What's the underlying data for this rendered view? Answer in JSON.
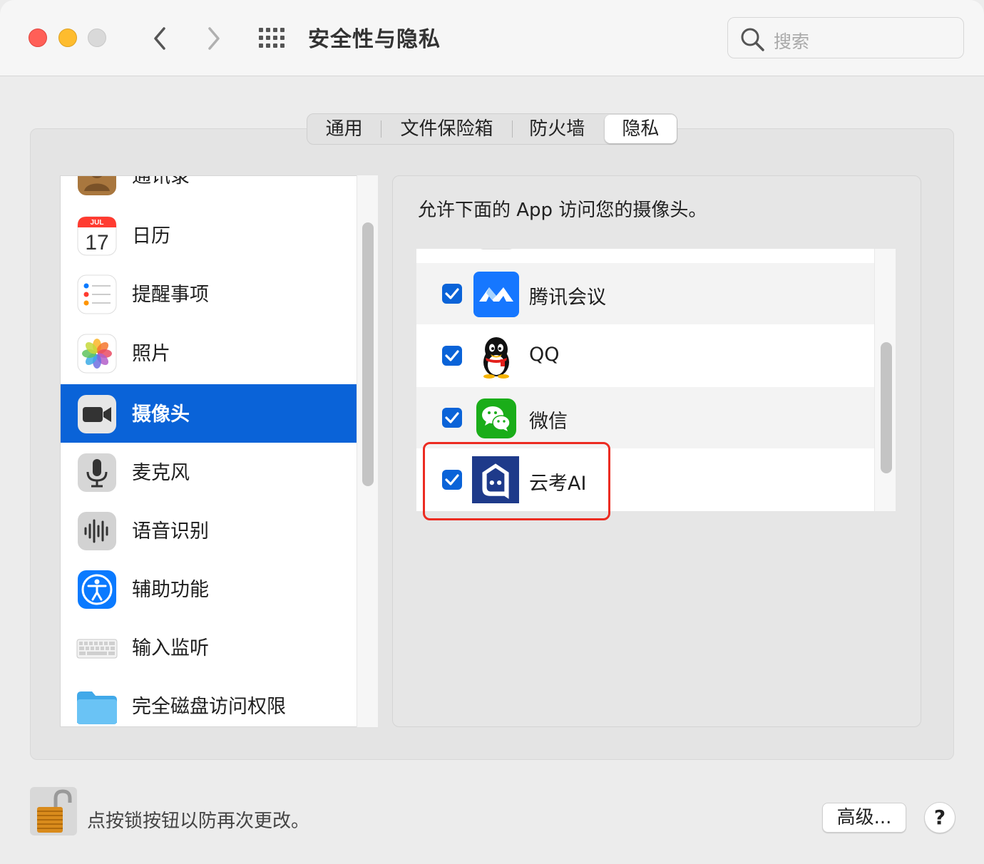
{
  "window": {
    "title": "安全性与隐私",
    "search_placeholder": "搜索"
  },
  "tabs": [
    {
      "label": "通用",
      "selected": false
    },
    {
      "label": "文件保险箱",
      "selected": false
    },
    {
      "label": "防火墙",
      "selected": false
    },
    {
      "label": "隐私",
      "selected": true
    }
  ],
  "sidebar": {
    "items": [
      {
        "label": "通讯录",
        "icon": "contacts-icon"
      },
      {
        "label": "日历",
        "icon": "calendar-icon",
        "icon_text_month": "JUL",
        "icon_text_day": "17"
      },
      {
        "label": "提醒事项",
        "icon": "reminders-icon"
      },
      {
        "label": "照片",
        "icon": "photos-icon"
      },
      {
        "label": "摄像头",
        "icon": "camera-icon",
        "selected": true
      },
      {
        "label": "麦克风",
        "icon": "microphone-icon"
      },
      {
        "label": "语音识别",
        "icon": "speech-recognition-icon"
      },
      {
        "label": "辅助功能",
        "icon": "accessibility-icon"
      },
      {
        "label": "输入监听",
        "icon": "keyboard-icon"
      },
      {
        "label": "完全磁盘访问权限",
        "icon": "folder-icon"
      }
    ]
  },
  "camera_pane": {
    "description": "允许下面的 App 访问您的摄像头。",
    "apps": [
      {
        "name": "腾讯会议",
        "checked": true,
        "icon": "tencent-meeting-icon"
      },
      {
        "name": "QQ",
        "checked": true,
        "icon": "qq-icon"
      },
      {
        "name": "微信",
        "checked": true,
        "icon": "wechat-icon"
      },
      {
        "name": "云考AI",
        "checked": true,
        "icon": "yunkao-ai-icon",
        "highlighted": true
      }
    ]
  },
  "footer": {
    "lock_text": "点按锁按钮以防再次更改。",
    "advanced_label": "高级...",
    "help_label": "?"
  },
  "colors": {
    "accent": "#0a63d8",
    "highlight": "#ec2c22"
  }
}
